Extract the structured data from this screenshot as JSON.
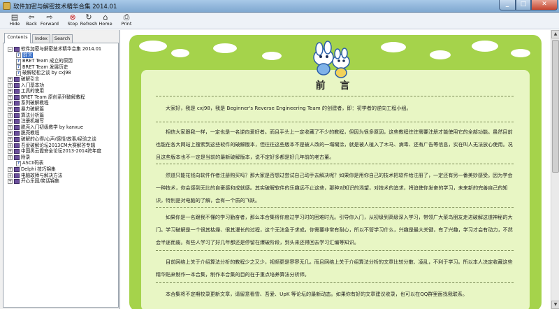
{
  "window": {
    "title": "软件加密与解密技术精华合集 2014.01"
  },
  "toolbar": [
    {
      "label": "Hide",
      "icon": "hide-icon"
    },
    {
      "label": "Back",
      "icon": "back-arrow-icon"
    },
    {
      "label": "Forward",
      "icon": "forward-arrow-icon"
    },
    {
      "label": "Stop",
      "icon": "stop-icon"
    },
    {
      "label": "Refresh",
      "icon": "refresh-icon"
    },
    {
      "label": "Home",
      "icon": "home-icon"
    },
    {
      "label": "Print",
      "icon": "print-icon"
    }
  ],
  "tabs": [
    "Contents",
    "Index",
    "Search"
  ],
  "tree": [
    {
      "label": "软件加密与解密技术精华合集 2014.01",
      "type": "book",
      "expander": "−"
    },
    {
      "label": "前言",
      "type": "page",
      "selected": true
    },
    {
      "label": "BRET Team 成立的原因",
      "type": "page"
    },
    {
      "label": "BRET Team 发展历史",
      "type": "page"
    },
    {
      "label": "破解轻松之谈 by cxj98",
      "type": "page"
    },
    {
      "label": "破解引言",
      "type": "book",
      "expander": "+"
    },
    {
      "label": "入门基本功",
      "type": "book",
      "expander": "+"
    },
    {
      "label": "工具的使用",
      "type": "book",
      "expander": "+"
    },
    {
      "label": "BRET Team 原创系列破解教程",
      "type": "book",
      "expander": "+"
    },
    {
      "label": "系列破解教程",
      "type": "book",
      "expander": "+"
    },
    {
      "label": "暴力破解篇",
      "type": "book",
      "expander": "+"
    },
    {
      "label": "算法分析篇",
      "type": "book",
      "expander": "+"
    },
    {
      "label": "注册机编写",
      "type": "book",
      "expander": "+"
    },
    {
      "label": "脱壳入门初级教学 by kanxue",
      "type": "book",
      "expander": "+"
    },
    {
      "label": "脱壳教程",
      "type": "book",
      "expander": "+"
    },
    {
      "label": "破解的心得/心声/感悟/故事/经验之谈",
      "type": "book",
      "expander": "+"
    },
    {
      "label": "吾爱破解论坛2013CM大赛解答专辑",
      "type": "book",
      "expander": "+"
    },
    {
      "label": "中国黑云霞安全论坛2013-2014跨年度",
      "type": "book",
      "expander": "+"
    },
    {
      "label": "附录",
      "type": "book",
      "expander": "+"
    },
    {
      "label": "ASCII码表",
      "type": "page"
    },
    {
      "label": "Delphi 技巧锦集",
      "type": "book",
      "expander": "+"
    },
    {
      "label": "电脑故障与解决方法",
      "type": "book",
      "expander": "+"
    },
    {
      "label": "开心乐园/笑话锦集",
      "type": "book",
      "expander": "+"
    }
  ],
  "article": {
    "title": "前 言",
    "paragraphs": [
      "大家好，我是 cxj98，我是 Beginner's Reverse Engineering Team 的创建者，即：初学者的逆向工程小组。",
      "相信大家跟我一样，一定也是一名逆向爱好者。而且手头上一定收藏了不少的教程，但因为很多原因，这些教程往往需要注册才能使用它的全部功能。虽然目前也能在各大网站上搜索到这些软件的破解版本，但往往这些版本不是被人改的一塌糊涂，就是被人植入了木马、病毒、还有广告等信息，实在叫人无法放心使用。况且这些版本也不一定是当前的最新破解版本，说不定好多都是好几年前的老古董。",
      "然道只能花钱向软件作者注册购买吗？那大家是否想过尝试自己动手去解决呢？如果你是用你自己的技术把软件给注册了，一定还有另一番美妙感受。因为学会一种技术，你会感到无比的自豪感和成就感。其实破解软件的乐趣远不止这些，那种对知识的渴望，对技术的追求，将迫使你发奋的学习，未来新的完善自己的知识，特别是对电脑的了解，会有一个质的飞跃。",
      "如果你是一名跟我不懂的学习勤奋者，那么本合集将你度过学习时的困难时光。引导你入门，从初级到高级深入学习，带领广大菜鸟朋友走进破解这道神秘的大门。学习破解是一个很其枯燥、很其漫长的过程，这个无法急于求成，你需要非常有耐心，所以不管学习什么，兴趣是最大关键，有了兴趣，学习才会有动力，不然会半途而废。有些人学习了好几年都还是停留在爆破阶段，到头来还得回去学习汇编等知识。",
      "目前网络上关于介绍算法分析的教程少之又少，视频更是寥寥无几。而且网络上关于介绍算法分析的文章比较分散、凌乱，不利于学习。所以本人决定收藏这些精华贴来制作一本合集，制作本合集的目的在于重点培养算法分析师。",
      "本合集将不定期校录更新文章，请留意看雪、吾爱、UpK 等论坛的最新动态。如果你有好的文章建议收录，也可以在QQ群里面找我联系。"
    ]
  },
  "colors": {
    "page_bg": "#a5d34b",
    "paper": "#e8f6c4",
    "selection": "#316ac5"
  }
}
